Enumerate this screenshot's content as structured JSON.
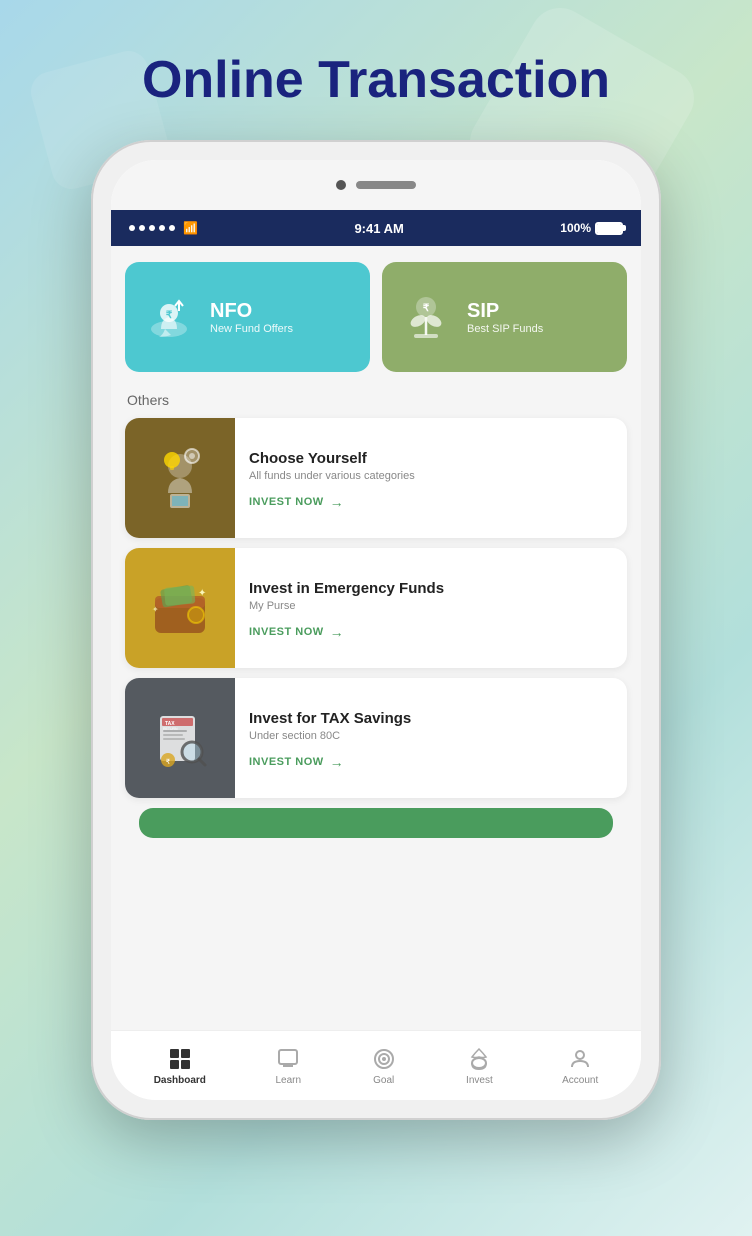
{
  "page": {
    "title": "Online Transaction",
    "background_colors": [
      "#a8d8ea",
      "#c8e6c9",
      "#b2dfdb"
    ]
  },
  "status_bar": {
    "time": "9:41 AM",
    "battery": "100%",
    "signal_dots": 5
  },
  "top_cards": [
    {
      "id": "nfo",
      "title": "NFO",
      "subtitle": "New Fund Offers",
      "color": "#4dc8d0",
      "icon": "nfo-icon"
    },
    {
      "id": "sip",
      "title": "SIP",
      "subtitle": "Best SIP Funds",
      "color": "#8fad6a",
      "icon": "sip-icon"
    }
  ],
  "others_label": "Others",
  "list_items": [
    {
      "id": "choose-yourself",
      "title": "Choose Yourself",
      "subtitle": "All funds under various categories",
      "cta": "INVEST NOW",
      "img_color": "img-brown",
      "icon": "person-thinking-icon"
    },
    {
      "id": "emergency-funds",
      "title": "Invest in Emergency Funds",
      "subtitle": "My Purse",
      "cta": "INVEST NOW",
      "img_color": "img-gold",
      "icon": "wallet-icon"
    },
    {
      "id": "tax-savings",
      "title": "Invest for TAX Savings",
      "subtitle": "Under section 80C",
      "cta": "INVEST NOW",
      "img_color": "img-dark",
      "icon": "tax-icon"
    }
  ],
  "bottom_nav": [
    {
      "id": "dashboard",
      "label": "Dashboard",
      "icon": "dashboard-icon",
      "active": true
    },
    {
      "id": "learn",
      "label": "Learn",
      "icon": "learn-icon",
      "active": false
    },
    {
      "id": "goal",
      "label": "Goal",
      "icon": "goal-icon",
      "active": false
    },
    {
      "id": "invest",
      "label": "Invest",
      "icon": "invest-icon",
      "active": false
    },
    {
      "id": "account",
      "label": "Account",
      "icon": "account-icon",
      "active": false
    }
  ]
}
